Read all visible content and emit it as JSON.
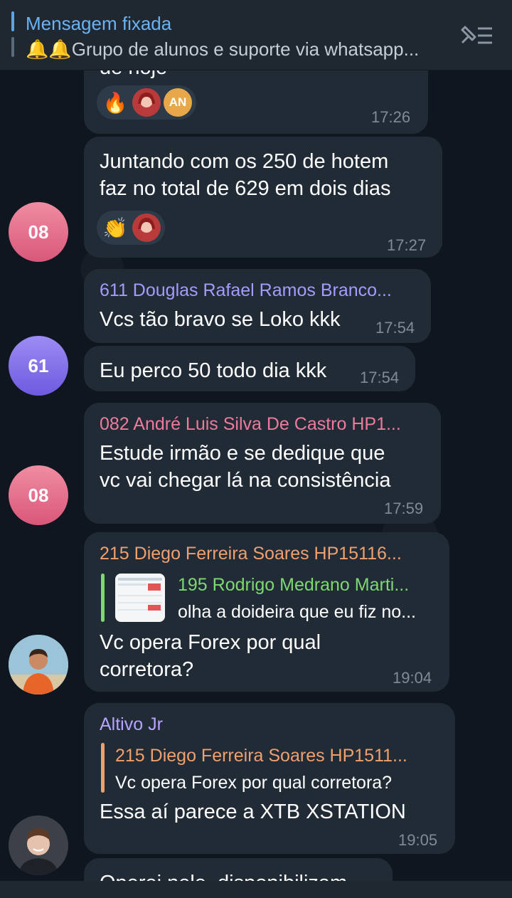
{
  "pinned": {
    "title": "Mensagem fixada",
    "text": "🔔🔔Grupo de alunos e suporte via whatsapp..."
  },
  "messages": [
    {
      "partial_text": "de hoje",
      "reactions": [
        "🔥",
        "girl-avatar",
        "AN"
      ],
      "time": "17:26"
    },
    {
      "text1": "Juntando com os 250 de hotem",
      "text2": "faz no total de 629 em dois dias",
      "reactions": [
        "👏",
        "girl-avatar"
      ],
      "time": "17:27",
      "avatar": "08"
    },
    {
      "sender": "611 Douglas Rafael Ramos Branco...",
      "text": "Vcs tão bravo se Loko kkk",
      "time": "17:54"
    },
    {
      "text": "Eu perco 50 todo dia kkk",
      "time": "17:54",
      "avatar": "61"
    },
    {
      "sender": "082 André Luis Silva De Castro HP1...",
      "text1": "Estude irmão e se dedique que",
      "text2": "vc vai chegar lá na consistência",
      "time": "17:59",
      "avatar": "08"
    },
    {
      "sender": "215 Diego Ferreira Soares HP15116...",
      "reply_sender": "195 Rodrigo Medrano Marti...",
      "reply_text": "olha a doideira que eu fiz no...",
      "text1": "Vc opera Forex por qual",
      "text2": "corretora?",
      "time": "19:04"
    },
    {
      "sender": "Altivo Jr",
      "reply_sender": "215 Diego Ferreira Soares HP1511...",
      "reply_text": "Vc opera Forex por qual corretora?",
      "text": "Essa aí parece a XTB XSTATION",
      "time": "19:05"
    },
    {
      "partial_text": "Operei nele, disponibilizam"
    }
  ],
  "colors": {
    "accent": "#6ab2f2",
    "bubble": "#212b36",
    "name_purple": "#a49bff",
    "name_pink": "#ee7a9c",
    "name_orange": "#f0a06e",
    "name_green": "#7fd86f",
    "name_violet": "#b7a3ff"
  }
}
